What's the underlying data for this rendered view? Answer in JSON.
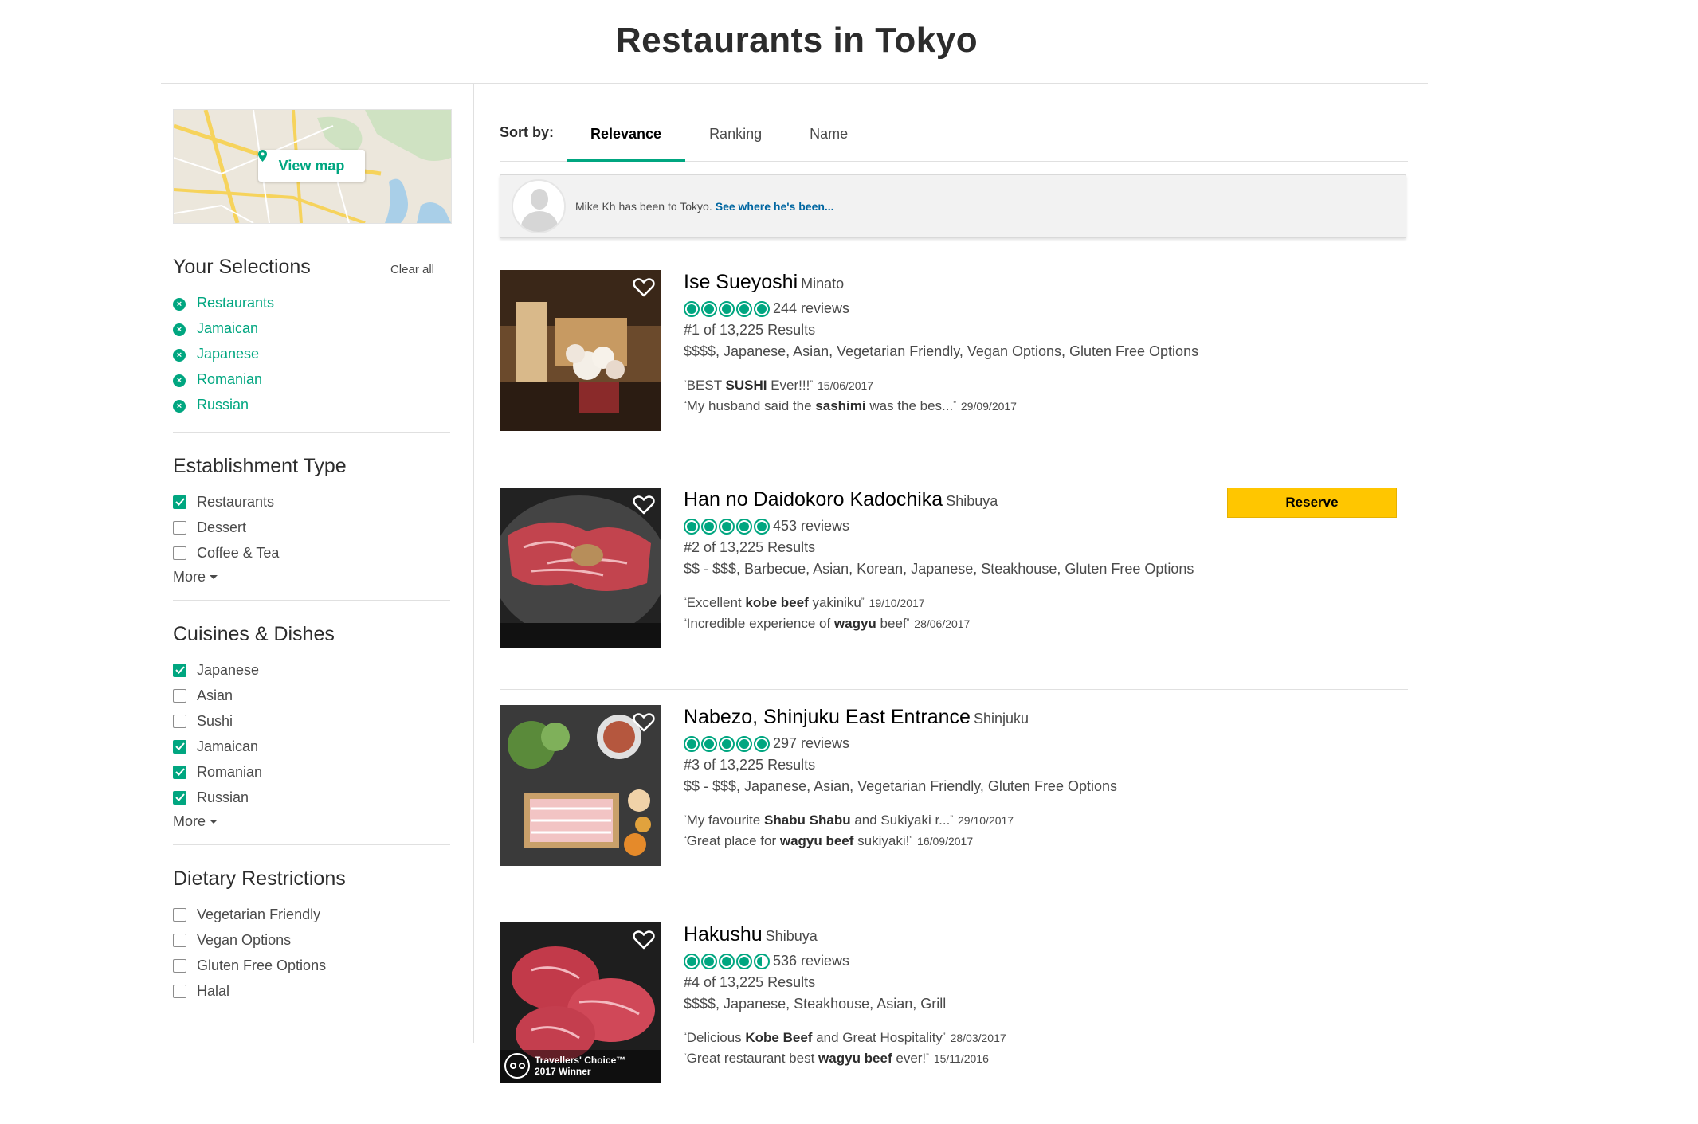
{
  "page": {
    "title": "Restaurants in Tokyo"
  },
  "sidebar": {
    "view_map_label": "View map",
    "your_selections": {
      "title": "Your Selections",
      "clear_all": "Clear all",
      "items": [
        "Restaurants",
        "Jamaican",
        "Japanese",
        "Romanian",
        "Russian"
      ]
    },
    "establishment_type": {
      "title": "Establishment Type",
      "options": [
        {
          "label": "Restaurants",
          "checked": true
        },
        {
          "label": "Dessert",
          "checked": false
        },
        {
          "label": "Coffee & Tea",
          "checked": false
        }
      ],
      "more_label": "More"
    },
    "cuisines": {
      "title": "Cuisines & Dishes",
      "options": [
        {
          "label": "Japanese",
          "checked": true
        },
        {
          "label": "Asian",
          "checked": false
        },
        {
          "label": "Sushi",
          "checked": false
        },
        {
          "label": "Jamaican",
          "checked": true
        },
        {
          "label": "Romanian",
          "checked": true
        },
        {
          "label": "Russian",
          "checked": true
        }
      ],
      "more_label": "More"
    },
    "dietary": {
      "title": "Dietary Restrictions",
      "options": [
        {
          "label": "Vegetarian Friendly",
          "checked": false
        },
        {
          "label": "Vegan Options",
          "checked": false
        },
        {
          "label": "Gluten Free Options",
          "checked": false
        },
        {
          "label": "Halal",
          "checked": false
        }
      ]
    }
  },
  "sort": {
    "label": "Sort by:",
    "tabs": [
      "Relevance",
      "Ranking",
      "Name"
    ],
    "active": "Relevance"
  },
  "banner": {
    "text": "Mike Kh has been to Tokyo.",
    "link": "See where he's been..."
  },
  "colors": {
    "accent": "#00a680",
    "reserve": "#ffc600",
    "link": "#0066a1"
  },
  "listings": [
    {
      "name": "Ise Sueyoshi",
      "neighborhood": "Minato",
      "rating": 5,
      "reviews": "244 reviews",
      "rank": "#1 of 13,225 Results",
      "tags": "$$$$, Japanese, Asian, Vegetarian Friendly, Vegan Options, Gluten Free Options",
      "reserve": "",
      "badge": "",
      "snippets": [
        {
          "pre": "BEST ",
          "bold": "SUSHI",
          "post": " Ever!!!",
          "date": "15/06/2017"
        },
        {
          "pre": "My husband said the ",
          "bold": "sashimi",
          "post": " was the bes...",
          "date": "29/09/2017"
        }
      ]
    },
    {
      "name": "Han no Daidokoro Kadochika",
      "neighborhood": "Shibuya",
      "rating": 5,
      "reviews": "453 reviews",
      "rank": "#2 of 13,225 Results",
      "tags": "$$ - $$$, Barbecue, Asian, Korean, Japanese, Steakhouse, Gluten Free Options",
      "reserve": "Reserve",
      "badge": "",
      "snippets": [
        {
          "pre": "Excellent ",
          "bold": "kobe beef",
          "post": " yakiniku",
          "date": "19/10/2017"
        },
        {
          "pre": "Incredible experience of ",
          "bold": "wagyu",
          "post": " beef",
          "date": "28/06/2017"
        }
      ]
    },
    {
      "name": "Nabezo, Shinjuku East Entrance",
      "neighborhood": "Shinjuku",
      "rating": 5,
      "reviews": "297 reviews",
      "rank": "#3 of 13,225 Results",
      "tags": "$$ - $$$, Japanese, Asian, Vegetarian Friendly, Gluten Free Options",
      "reserve": "",
      "badge": "",
      "snippets": [
        {
          "pre": "My favourite ",
          "bold": "Shabu Shabu",
          "post": " and Sukiyaki r...",
          "date": "29/10/2017"
        },
        {
          "pre": "Great place for ",
          "bold": "wagyu beef",
          "post": " sukiyaki!",
          "date": "16/09/2017"
        }
      ]
    },
    {
      "name": "Hakushu",
      "neighborhood": "Shibuya",
      "rating": 4.5,
      "reviews": "536 reviews",
      "rank": "#4 of 13,225 Results",
      "tags": "$$$$, Japanese, Steakhouse, Asian, Grill",
      "reserve": "",
      "badge": "Travellers' Choice™ 2017 Winner",
      "snippets": [
        {
          "pre": "Delicious ",
          "bold": "Kobe Beef",
          "post": " and Great Hospitality",
          "date": "28/03/2017"
        },
        {
          "pre": "Great restaurant best ",
          "bold": "wagyu beef",
          "post": " ever!",
          "date": "15/11/2016"
        }
      ]
    }
  ]
}
